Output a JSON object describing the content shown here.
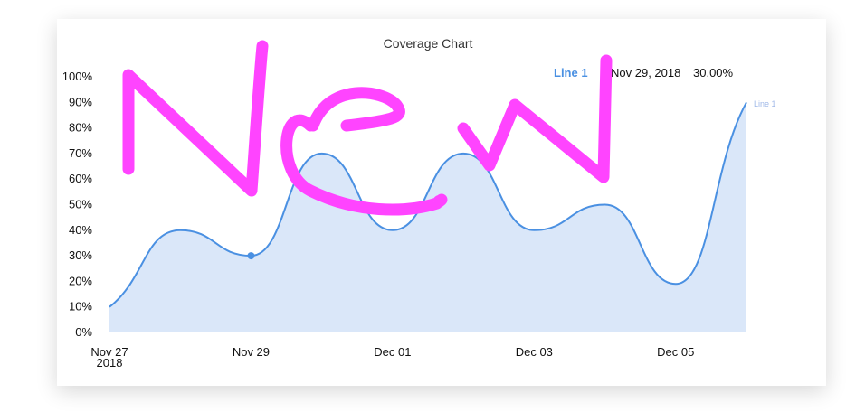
{
  "colors": {
    "line": "#4A90E2",
    "area": "#DAE7F9",
    "scribble": "#FF44FF",
    "end_label": "#9FB8E8"
  },
  "chart_data": {
    "type": "area",
    "title": "Coverage Chart",
    "xlabel": "",
    "ylabel": "",
    "ylim": [
      0,
      100
    ],
    "y_tick_labels": [
      "0%",
      "10%",
      "20%",
      "30%",
      "40%",
      "50%",
      "60%",
      "70%",
      "80%",
      "90%",
      "100%"
    ],
    "x": [
      "2018-11-27",
      "2018-11-28",
      "2018-11-29",
      "2018-11-30",
      "2018-12-01",
      "2018-12-02",
      "2018-12-03",
      "2018-12-04",
      "2018-12-05",
      "2018-12-06"
    ],
    "x_tick_labels": [
      "Nov 27",
      "Nov 29",
      "Dec 01",
      "Dec 03",
      "Dec 05"
    ],
    "x_year_label": "2018",
    "series": [
      {
        "name": "Line 1",
        "values": [
          10,
          40,
          30,
          70,
          40,
          70,
          40,
          50,
          19,
          90
        ]
      }
    ],
    "end_label": "Line 1",
    "highlight": {
      "index": 2,
      "series_label": "Line 1",
      "date_label": "Nov 29, 2018",
      "value_label": "30.00%"
    },
    "annotation": "New"
  }
}
